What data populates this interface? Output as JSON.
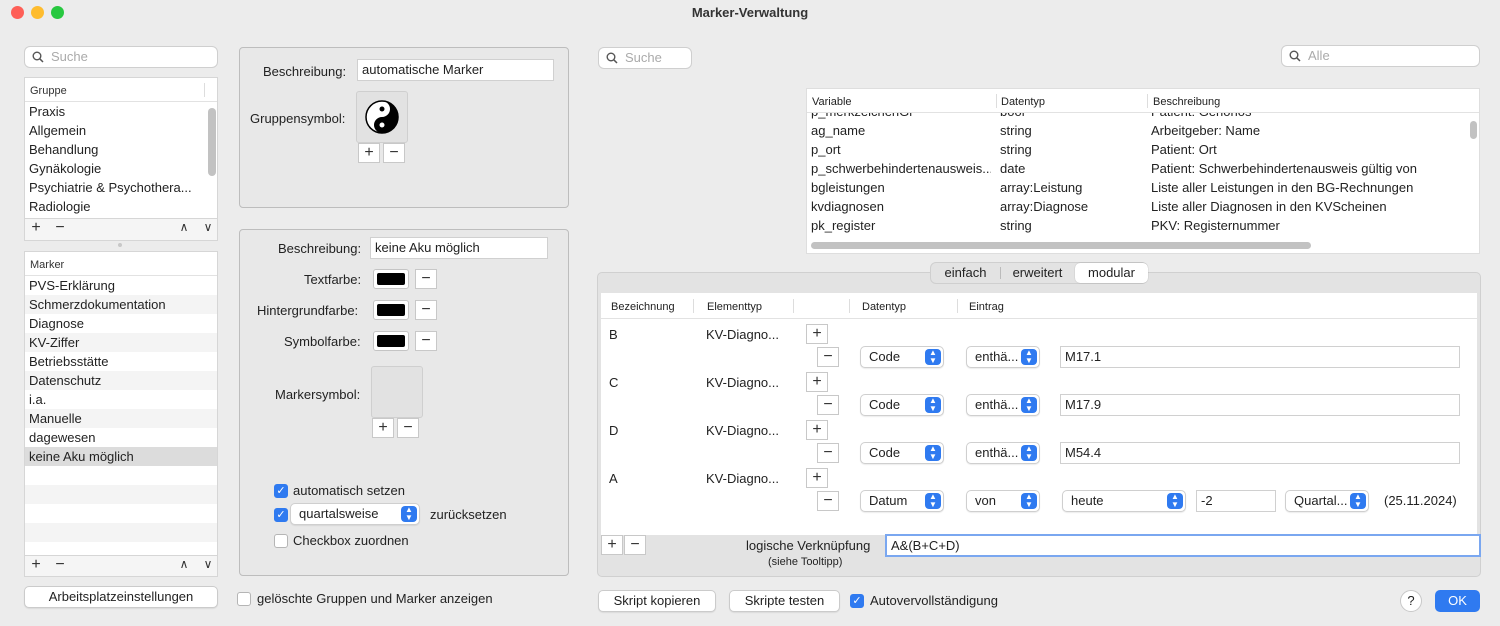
{
  "window": {
    "title": "Marker-Verwaltung"
  },
  "left": {
    "search_placeholder": "Suche",
    "groups_header": "Gruppe",
    "groups": [
      "Praxis",
      "Allgemein",
      "Behandlung",
      "Gynäkologie",
      "Psychiatrie & Psychothera...",
      "Radiologie"
    ],
    "markers_header": "Marker",
    "markers": [
      "PVS-Erklärung",
      "Schmerzdokumentation",
      "Diagnose",
      "KV-Ziffer",
      "Betriebsstätte",
      "Datenschutz",
      "i.a.",
      "Manuelle",
      "dagewesen",
      "keine Aku möglich"
    ],
    "selected_marker": "keine Aku möglich",
    "workplace_button": "Arbeitsplatzeinstellungen",
    "show_deleted_label": "gelöschte Gruppen und Marker anzeigen"
  },
  "group_panel": {
    "description_label": "Beschreibung:",
    "description_value": "automatische Marker",
    "symbol_label": "Gruppensymbol:"
  },
  "marker_panel": {
    "description_label": "Beschreibung:",
    "description_value": "keine Aku möglich",
    "textcolor_label": "Textfarbe:",
    "bgcolor_label": "Hintergrundfarbe:",
    "symbolcolor_label": "Symbolfarbe:",
    "markersymbol_label": "Markersymbol:",
    "auto_set_label": "automatisch setzen",
    "reset_period": "quartalsweise",
    "reset_label": "zurücksetzen",
    "checkbox_assign_label": "Checkbox zuordnen"
  },
  "right": {
    "search_placeholder": "Suche",
    "filter_placeholder": "Alle",
    "var_headers": [
      "Variable",
      "Datentyp",
      "Beschreibung"
    ],
    "variables": [
      {
        "name": "p_merkzeichenGl",
        "type": "bool",
        "desc": "Patient: Gehörlos"
      },
      {
        "name": "ag_name",
        "type": "string",
        "desc": "Arbeitgeber: Name"
      },
      {
        "name": "p_ort",
        "type": "string",
        "desc": "Patient: Ort"
      },
      {
        "name": "p_schwerbehindertenausweis...",
        "type": "date",
        "desc": "Patient: Schwerbehindertenausweis gültig von"
      },
      {
        "name": "bgleistungen",
        "type": "array:Leistung",
        "desc": "Liste aller Leistungen in den BG-Rechnungen"
      },
      {
        "name": "kvdiagnosen",
        "type": "array:Diagnose",
        "desc": "Liste aller Diagnosen in den KVScheinen"
      },
      {
        "name": "pk_register",
        "type": "string",
        "desc": "PKV: Registernummer"
      }
    ],
    "tabs": [
      "einfach",
      "erweitert",
      "modular"
    ],
    "active_tab": "modular",
    "rule_headers": [
      "Bezeichnung",
      "Elementtyp",
      "Datentyp",
      "Eintrag"
    ],
    "rules": [
      {
        "name": "B",
        "elementtype": "KV-Diagno...",
        "datatype": "Code",
        "op": "enthä...",
        "value": "M17.1"
      },
      {
        "name": "C",
        "elementtype": "KV-Diagno...",
        "datatype": "Code",
        "op": "enthä...",
        "value": "M17.9"
      },
      {
        "name": "D",
        "elementtype": "KV-Diagno...",
        "datatype": "Code",
        "op": "enthä...",
        "value": "M54.4"
      },
      {
        "name": "A",
        "elementtype": "KV-Diagno...",
        "datatype": "Datum",
        "op": "von",
        "value": "heute",
        "offset": "-2",
        "unit": "Quartal...",
        "result": "(25.11.2024)"
      }
    ],
    "logic_label": "logische Verknüpfung",
    "logic_hint": "(siehe Tooltipp)",
    "logic_value": "A&(B+C+D)",
    "copy_script": "Skript kopieren",
    "test_scripts": "Skripte testen",
    "autocomplete_label": "Autovervollständigung",
    "help": "?",
    "ok": "OK"
  },
  "colors": {
    "accent": "#2f7af0",
    "window_bg": "#ececec",
    "traffic_red": "#fe5f57",
    "traffic_yellow": "#febc2e",
    "traffic_green": "#28c840"
  }
}
